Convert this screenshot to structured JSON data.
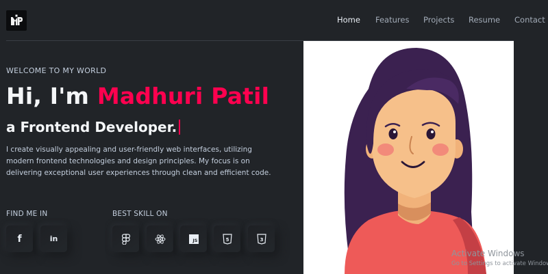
{
  "header": {
    "logo_text": "MP",
    "nav": [
      {
        "label": "Home",
        "active": true
      },
      {
        "label": "Features",
        "active": false
      },
      {
        "label": "Projects",
        "active": false
      },
      {
        "label": "Resume",
        "active": false
      },
      {
        "label": "Contact",
        "active": false
      }
    ]
  },
  "hero": {
    "welcome": "WELCOME TO MY WORLD",
    "greeting": "Hi, I'm ",
    "name": "Madhuri Patil",
    "subtitle": "a Frontend Developer.",
    "description": "I create visually appealing and user-friendly web interfaces, utilizing modern frontend technologies and design principles. My focus is on delivering exceptional user experiences through clean and efficient code."
  },
  "social": {
    "label": "FIND ME IN",
    "items": [
      {
        "name": "facebook-icon",
        "glyph": "f"
      },
      {
        "name": "linkedin-icon",
        "glyph": "in"
      }
    ]
  },
  "skills": {
    "label": "BEST SKILL ON",
    "items": [
      {
        "name": "figma-icon"
      },
      {
        "name": "react-icon"
      },
      {
        "name": "javascript-icon",
        "glyph": "JS"
      },
      {
        "name": "html5-icon",
        "glyph": "5"
      },
      {
        "name": "css3-icon",
        "glyph": "3"
      }
    ]
  },
  "colors": {
    "background": "#212428",
    "accent": "#ff014f",
    "text": "#c4cfde"
  },
  "os_watermark": {
    "title": "Activate Windows",
    "subtitle": "Go to Settings to activate Windows."
  }
}
